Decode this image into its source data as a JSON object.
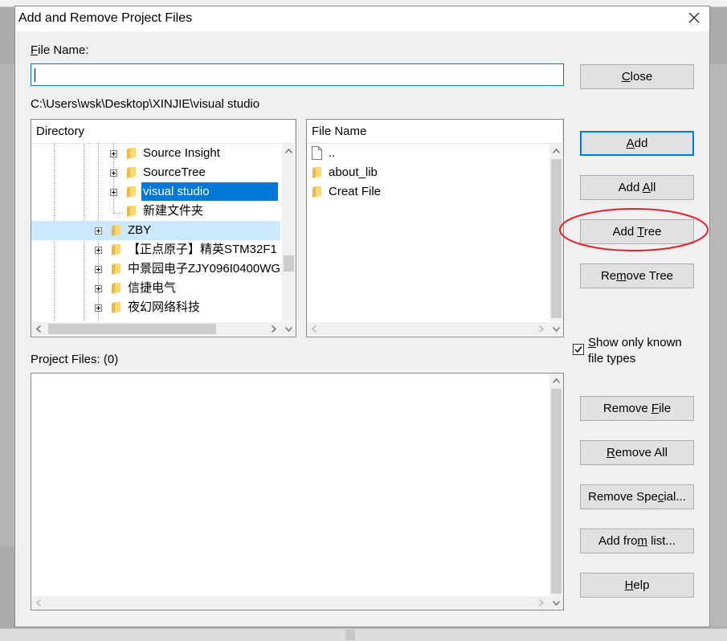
{
  "dialog": {
    "title": "Add and Remove Project Files",
    "file_name_label": "File Name:",
    "file_name_value": "",
    "path": "C:\\Users\\wsk\\Desktop\\XINJIE\\visual studio",
    "project_files_label": "Project Files: (0)",
    "show_known_line1": "Show only known",
    "show_known_line2": "file types",
    "show_known_checked": true
  },
  "directory": {
    "header": "Directory",
    "items": [
      {
        "label": "Source Insight",
        "expandable": true,
        "selected": false
      },
      {
        "label": "SourceTree",
        "expandable": true,
        "selected": false
      },
      {
        "label": "visual studio",
        "expandable": true,
        "selected": true
      },
      {
        "label": "新建文件夹",
        "expandable": false,
        "selected": false
      },
      {
        "label": "ZBY",
        "expandable": true,
        "selected": false,
        "highlighted": true
      },
      {
        "label": "【正点原子】精英STM32F1",
        "expandable": true,
        "selected": false
      },
      {
        "label": "中景园电子ZJY096I0400WG",
        "expandable": true,
        "selected": false
      },
      {
        "label": "信捷电气",
        "expandable": true,
        "selected": false
      },
      {
        "label": "夜幻网络科技",
        "expandable": true,
        "selected": false
      }
    ]
  },
  "files": {
    "header": "File Name",
    "items": [
      {
        "label": "..",
        "icon": "file-icon"
      },
      {
        "label": "about_lib",
        "icon": "folder-icon"
      },
      {
        "label": "Creat File",
        "icon": "folder-icon"
      }
    ]
  },
  "buttons": {
    "close": {
      "pre": "",
      "key": "C",
      "post": "lose"
    },
    "add": {
      "pre": "",
      "key": "A",
      "post": "dd"
    },
    "add_all": {
      "pre": "Add ",
      "key": "A",
      "post": "ll"
    },
    "add_tree": {
      "pre": "Add ",
      "key": "T",
      "post": "ree"
    },
    "remove_tree": {
      "pre": "Re",
      "key": "m",
      "post": "ove Tree"
    },
    "remove_file": {
      "pre": "Remove ",
      "key": "F",
      "post": "ile"
    },
    "remove_all": {
      "pre": "",
      "key": "R",
      "post": "emove All"
    },
    "remove_special": {
      "pre": "Remove Spe",
      "key": "c",
      "post": "ial..."
    },
    "add_from_list": {
      "pre": "Add fro",
      "key": "m",
      "post": " list..."
    },
    "help": {
      "pre": "",
      "key": "H",
      "post": "elp"
    }
  },
  "file_name_key": {
    "pre": "",
    "key": "F",
    "post": "ile Name:"
  },
  "show_known_key": {
    "pre": "",
    "key": "S",
    "post": "how only known"
  },
  "colors": {
    "selection": "#0078d7",
    "highlight": "#cce8ff",
    "annotation": "#e8202a",
    "folder": "#f8d775"
  }
}
